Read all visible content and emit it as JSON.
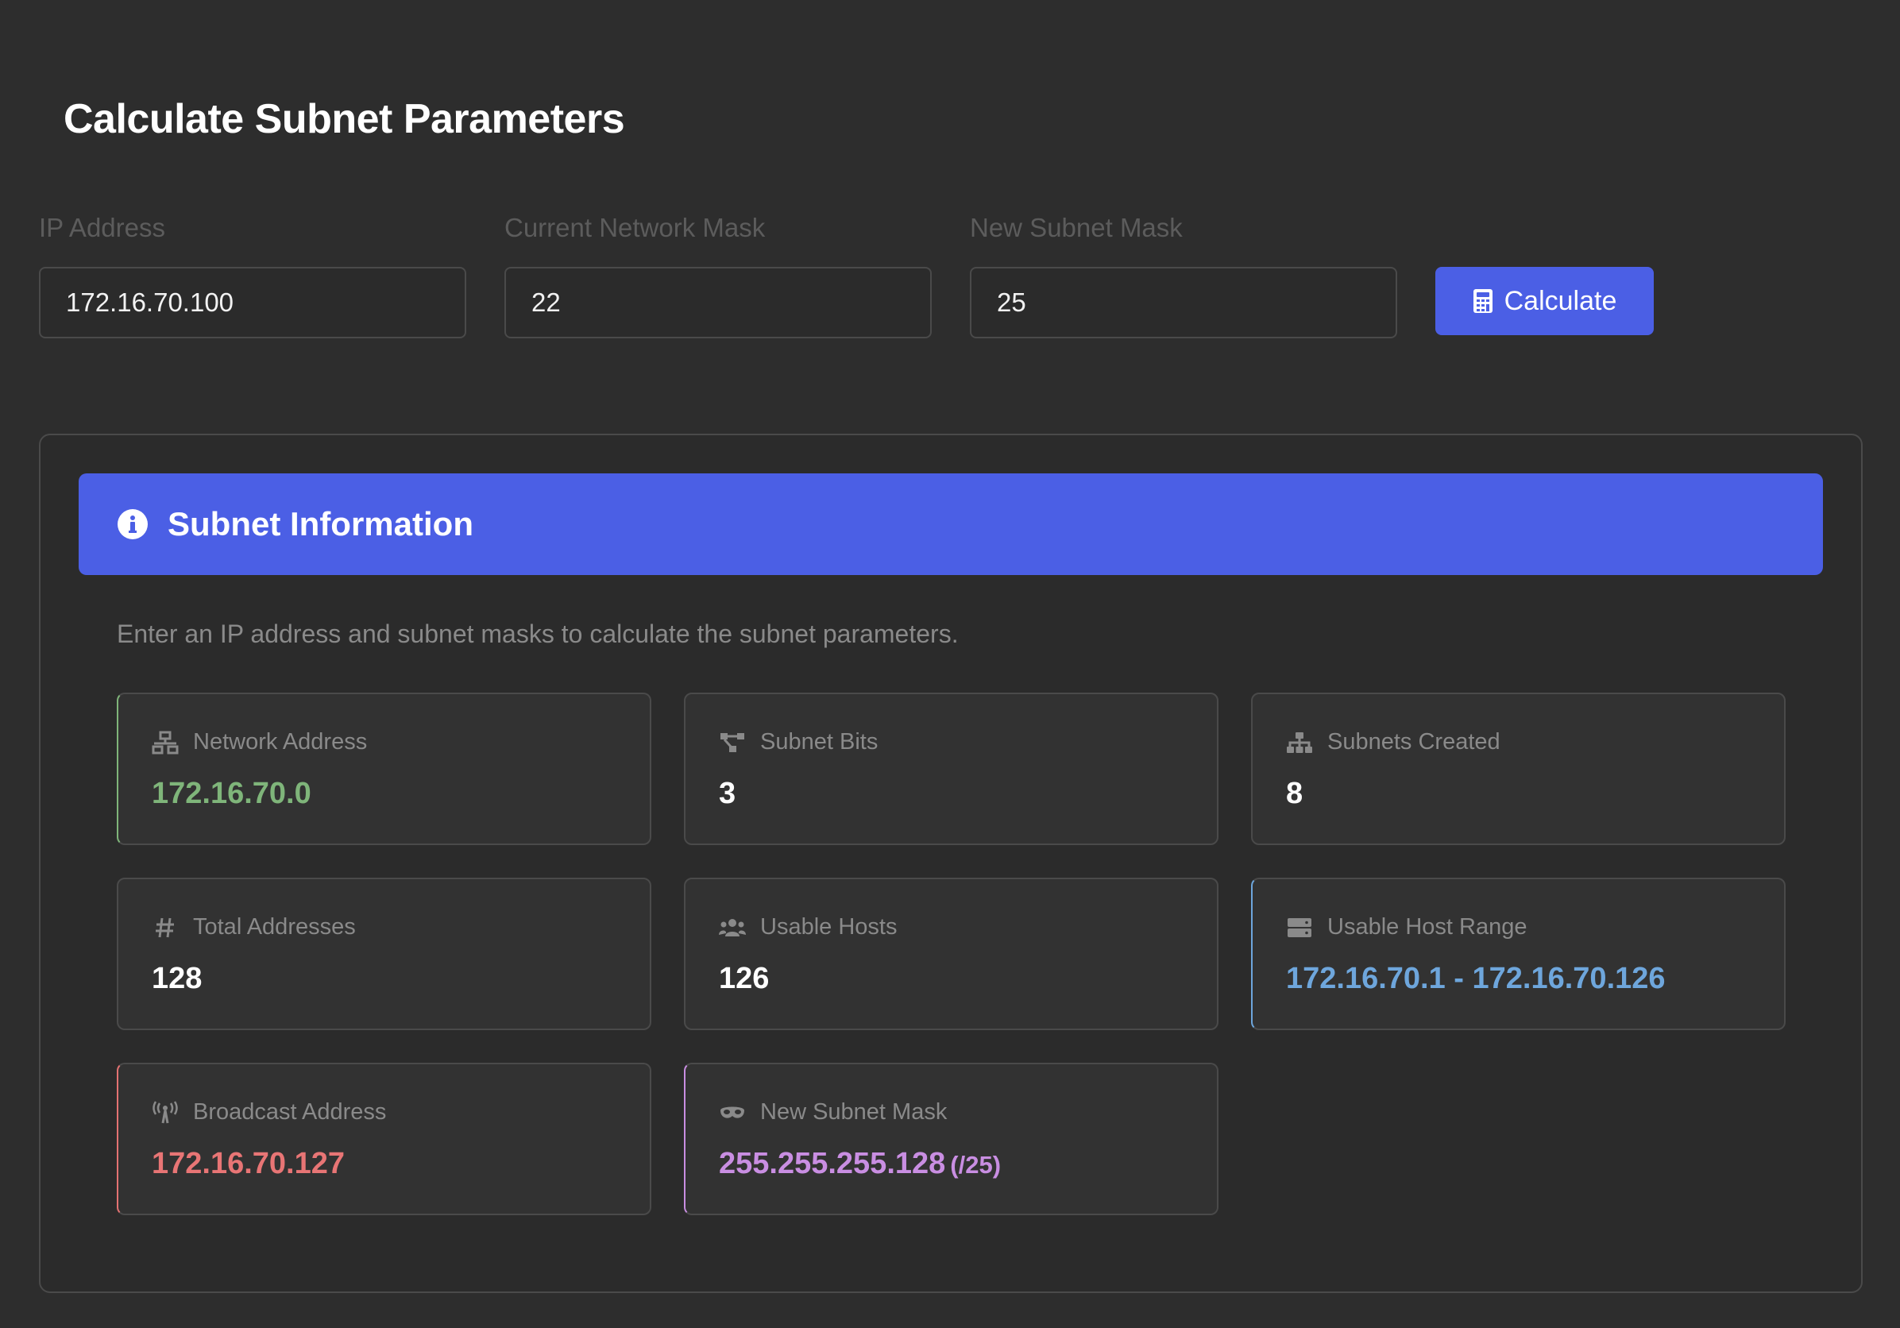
{
  "page": {
    "title": "Calculate Subnet Parameters"
  },
  "form": {
    "ip_address": {
      "label": "IP Address",
      "value": "172.16.70.100"
    },
    "current_mask": {
      "label": "Current Network Mask",
      "value": "22"
    },
    "new_mask": {
      "label": "New Subnet Mask",
      "value": "25"
    },
    "calculate_label": "Calculate"
  },
  "results": {
    "header_title": "Subnet Information",
    "description": "Enter an IP address and subnet masks to calculate the subnet parameters.",
    "cards": {
      "network_address": {
        "label": "Network Address",
        "value": "172.16.70.0",
        "icon": "network-wired-icon"
      },
      "subnet_bits": {
        "label": "Subnet Bits",
        "value": "3",
        "icon": "project-diagram-icon"
      },
      "subnets_created": {
        "label": "Subnets Created",
        "value": "8",
        "icon": "sitemap-icon"
      },
      "total_addresses": {
        "label": "Total Addresses",
        "value": "128",
        "icon": "hashtag-icon"
      },
      "usable_hosts": {
        "label": "Usable Hosts",
        "value": "126",
        "icon": "users-icon"
      },
      "usable_host_range": {
        "label": "Usable Host Range",
        "value": "172.16.70.1 - 172.16.70.126",
        "icon": "server-icon"
      },
      "broadcast_address": {
        "label": "Broadcast Address",
        "value": "172.16.70.127",
        "icon": "broadcast-tower-icon"
      },
      "new_subnet_mask": {
        "label": "New Subnet Mask",
        "value": "255.255.255.128",
        "suffix": "(/25)",
        "icon": "mask-icon"
      }
    }
  },
  "colors": {
    "background": "#2d2d2d",
    "accent": "#4b5fe5",
    "green": "#7fb57a",
    "blue": "#6ea6dc",
    "red": "#e87575",
    "purple": "#c98ee2"
  }
}
